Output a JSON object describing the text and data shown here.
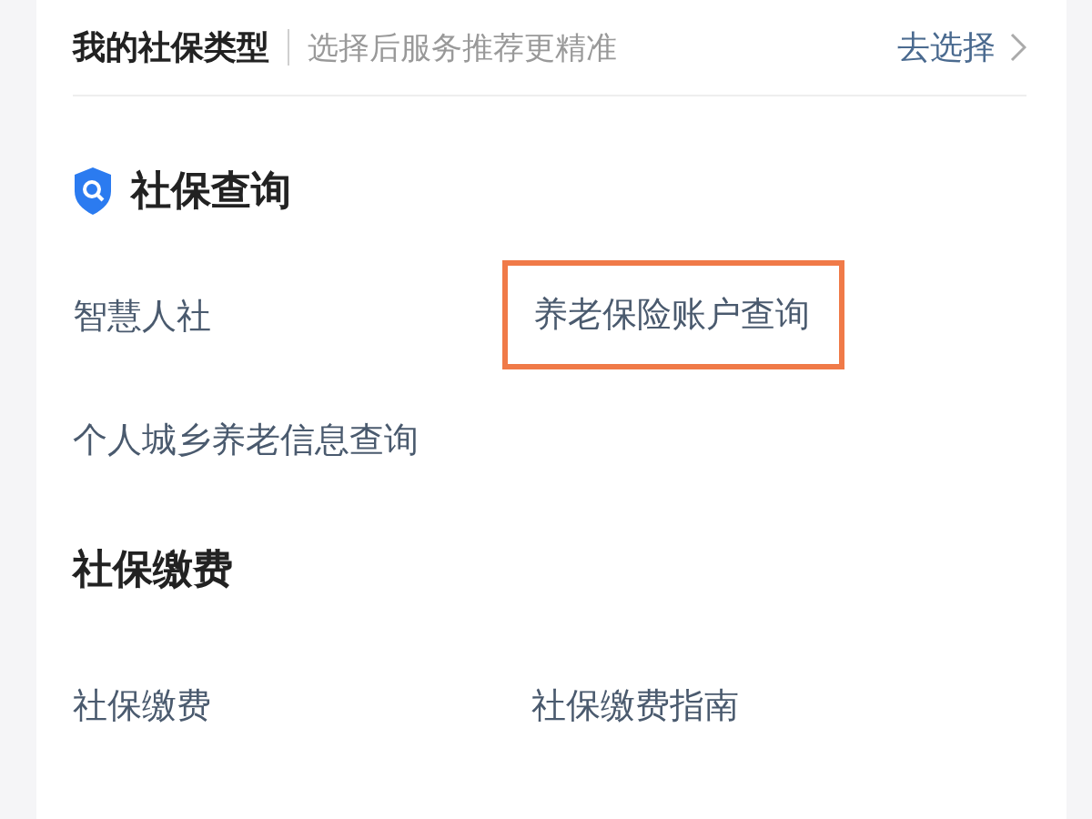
{
  "header": {
    "title": "我的社保类型",
    "hint": "选择后服务推荐更精准",
    "action": "去选择"
  },
  "sections": [
    {
      "title": "社保查询",
      "icon": true,
      "items": [
        {
          "label": "智慧人社",
          "highlighted": false
        },
        {
          "label": "养老保险账户查询",
          "highlighted": true
        },
        {
          "label": "个人城乡养老信息查询",
          "highlighted": false
        }
      ]
    },
    {
      "title": "社保缴费",
      "icon": false,
      "items": [
        {
          "label": "社保缴费",
          "highlighted": false
        },
        {
          "label": "社保缴费指南",
          "highlighted": false
        }
      ]
    }
  ]
}
